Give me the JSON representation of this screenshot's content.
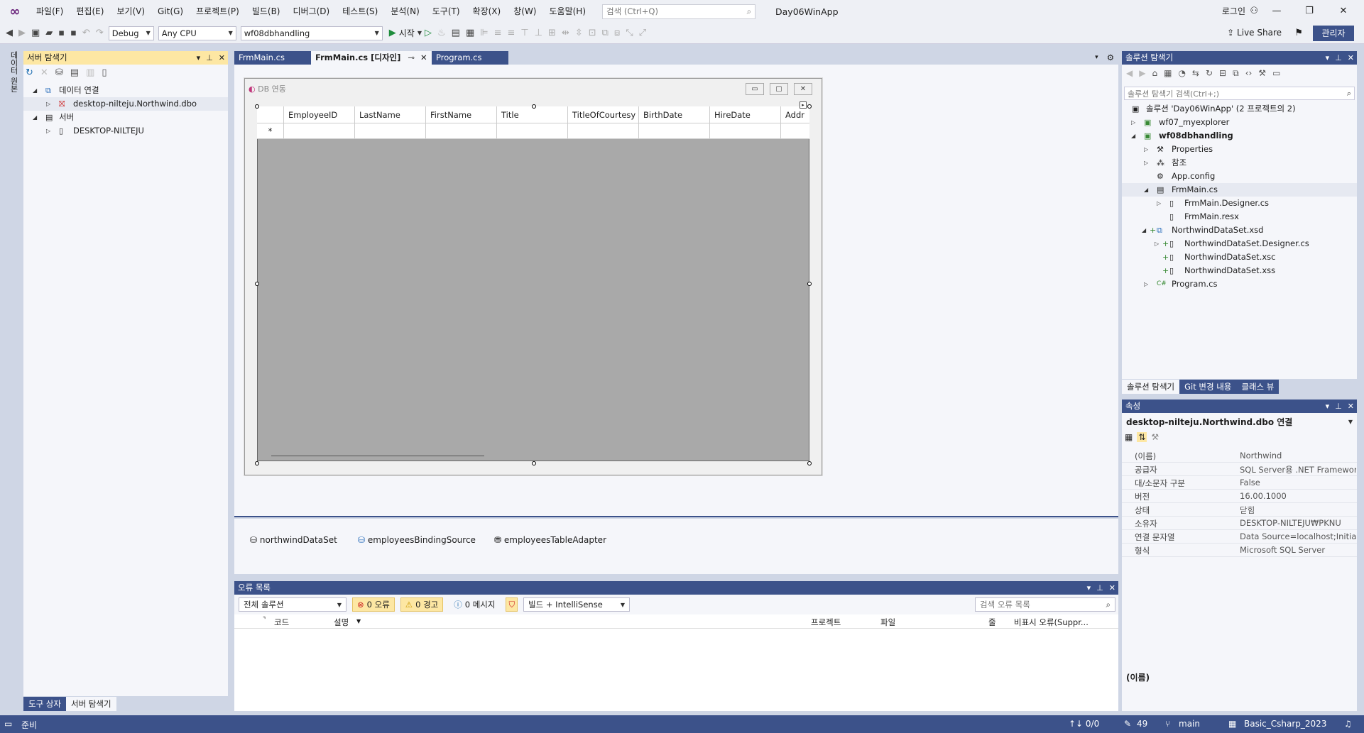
{
  "menubar": {
    "items": [
      "파일(F)",
      "편집(E)",
      "보기(V)",
      "Git(G)",
      "프로젝트(P)",
      "빌드(B)",
      "디버그(D)",
      "테스트(S)",
      "분석(N)",
      "도구(T)",
      "확장(X)",
      "창(W)",
      "도움말(H)"
    ],
    "search_placeholder": "검색 (Ctrl+Q)",
    "app_title": "Day06WinApp",
    "login_label": "로그인"
  },
  "toolbar": {
    "config": "Debug",
    "platform": "Any CPU",
    "startup_project": "wf08dbhandling",
    "start_label": "시작",
    "liveshare_label": "Live Share",
    "admin_label": "관리자"
  },
  "left_strip": {
    "label": "데이터 원본"
  },
  "server_explorer": {
    "title": "서버 탐색기",
    "nodes": [
      {
        "label": "데이터 연결"
      },
      {
        "label": "desktop-nilteju.Northwind.dbo"
      },
      {
        "label": "서버"
      },
      {
        "label": "DESKTOP-NILTEJU"
      }
    ],
    "bottom_tabs": [
      "도구 상자",
      "서버 탐색기"
    ]
  },
  "doc_tabs": [
    {
      "label": "FrmMain.cs"
    },
    {
      "label": "FrmMain.cs [디자인]"
    },
    {
      "label": "Program.cs"
    }
  ],
  "form": {
    "title": "DB 연동",
    "columns": [
      "EmployeeID",
      "LastName",
      "FirstName",
      "Title",
      "TitleOfCourtesy",
      "BirthDate",
      "HireDate",
      "Addr"
    ],
    "new_row_marker": "*"
  },
  "components": [
    "northwindDataSet",
    "employeesBindingSource",
    "employeesTableAdapter"
  ],
  "error_list": {
    "title": "오류 목록",
    "scope": "전체 솔루션",
    "errors_label": "0 오류",
    "warnings_label": "0 경고",
    "messages_label": "0 메시지",
    "build_filter": "빌드 + IntelliSense",
    "search_placeholder": "검색 오류 목록",
    "columns": [
      "코드",
      "설명",
      "프로젝트",
      "파일",
      "줄",
      "비표시 오류(Suppr..."
    ]
  },
  "solution_explorer": {
    "title": "솔루션 탐색기",
    "search_placeholder": "솔루션 탐색기 검색(Ctrl+;)",
    "nodes": [
      {
        "label": "솔루션 'Day06WinApp' (2 프로젝트의 2)"
      },
      {
        "label": "wf07_myexplorer"
      },
      {
        "label": "wf08dbhandling"
      },
      {
        "label": "Properties"
      },
      {
        "label": "참조"
      },
      {
        "label": "App.config"
      },
      {
        "label": "FrmMain.cs"
      },
      {
        "label": "FrmMain.Designer.cs"
      },
      {
        "label": "FrmMain.resx"
      },
      {
        "label": "NorthwindDataSet.xsd"
      },
      {
        "label": "NorthwindDataSet.Designer.cs"
      },
      {
        "label": "NorthwindDataSet.xsc"
      },
      {
        "label": "NorthwindDataSet.xss"
      },
      {
        "label": "Program.cs"
      }
    ],
    "bottom_tabs": [
      "솔루션 탐색기",
      "Git 변경 내용",
      "클래스 뷰"
    ]
  },
  "properties": {
    "title": "속성",
    "object": "desktop-nilteju.Northwind.dbo  연결",
    "rows": [
      {
        "key": "(이름)",
        "value": "Northwind"
      },
      {
        "key": "공급자",
        "value": "SQL Server용 .NET Framework"
      },
      {
        "key": "대/소문자 구분",
        "value": "False"
      },
      {
        "key": "버전",
        "value": "16.00.1000"
      },
      {
        "key": "상태",
        "value": "닫힘"
      },
      {
        "key": "소유자",
        "value": "DESKTOP-NILTEJU₩PKNU"
      },
      {
        "key": "연결 문자열",
        "value": "Data Source=localhost;Initial C"
      },
      {
        "key": "형식",
        "value": "Microsoft SQL Server"
      }
    ],
    "description_title": "(이름)"
  },
  "statusbar": {
    "ready": "준비",
    "sync": "↑↓ 0/0",
    "edits": "49",
    "branch": "main",
    "repo": "Basic_Csharp_2023"
  },
  "colors": {
    "accent": "#3c528a",
    "highlight": "#fde7a3",
    "shell": "#cfd6e5"
  }
}
